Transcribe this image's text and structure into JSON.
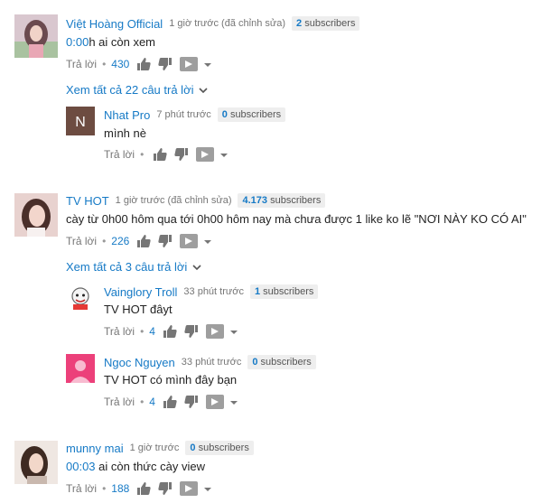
{
  "labels": {
    "reply": "Trả lời",
    "dot": "•"
  },
  "comments": [
    {
      "author": "Việt Hoàng Official",
      "time": "1 giờ trước (đã chỉnh sửa)",
      "subs_count": "2",
      "subs_label": "subscribers",
      "timestamp": "0:00",
      "text": "h ai còn xem",
      "likes": "430",
      "view_all": "Xem tất cả 22 câu trả lời",
      "replies": [
        {
          "author": "Nhat Pro",
          "time": "7 phút trước",
          "subs_count": "0",
          "subs_label": "subscribers",
          "text": "mình nè",
          "likes": ""
        }
      ]
    },
    {
      "author": "TV HOT",
      "time": "1 giờ trước (đã chỉnh sửa)",
      "subs_count": "4.173",
      "subs_label": "subscribers",
      "timestamp": "",
      "text": "cày từ 0h00 hôm qua tới 0h00 hôm nay mà chưa được 1 like ko lẽ \"NƠI NÀY KO CÓ AI\"",
      "likes": "226",
      "view_all": "Xem tất cả 3 câu trả lời",
      "replies": [
        {
          "author": "Vainglory Troll",
          "time": "33 phút trước",
          "subs_count": "1",
          "subs_label": "subscribers",
          "text": "TV HOT đâyt",
          "likes": "4"
        },
        {
          "author": "Ngoc Nguyen",
          "time": "33 phút trước",
          "subs_count": "0",
          "subs_label": "subscribers",
          "text": "TV HOT có mình đây bạn",
          "likes": "4"
        }
      ]
    },
    {
      "author": "munny mai",
      "time": "1 giờ trước",
      "subs_count": "0",
      "subs_label": "subscribers",
      "timestamp": "00:03",
      "text": " ai còn thức cày view",
      "likes": "188"
    }
  ]
}
